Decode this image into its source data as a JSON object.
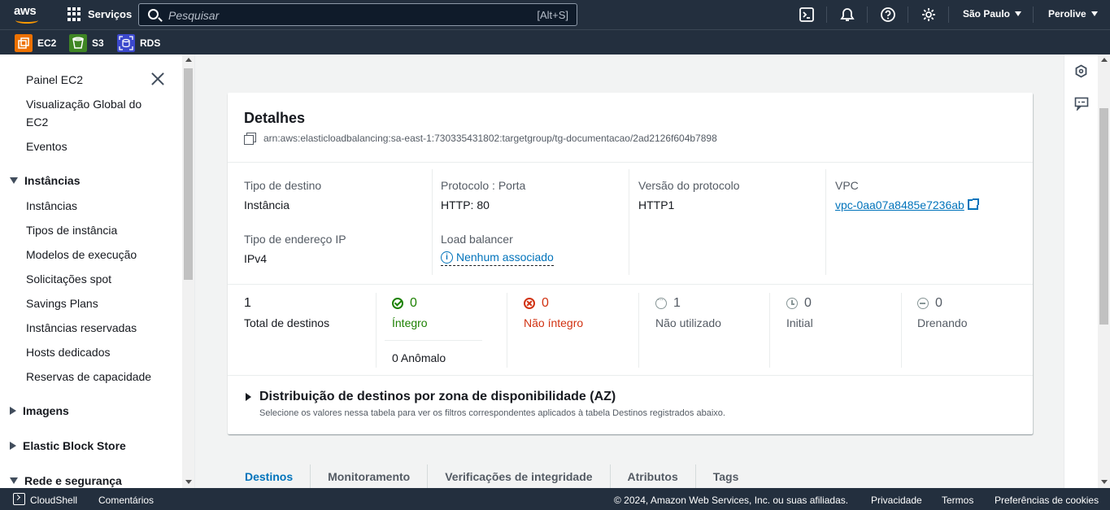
{
  "topnav": {
    "logo": "aws",
    "services_label": "Serviços",
    "search_placeholder": "Pesquisar",
    "search_shortcut": "[Alt+S]",
    "region": "São Paulo",
    "account": "Perolive",
    "icons": [
      "cloudshell-icon",
      "bell-icon",
      "help-icon",
      "gear-icon"
    ]
  },
  "favorites": [
    {
      "label": "EC2",
      "color": "#ed7100"
    },
    {
      "label": "S3",
      "color": "#3f8624"
    },
    {
      "label": "RDS",
      "color": "#3b48cc"
    }
  ],
  "sidebar": {
    "top_items": [
      "Painel EC2",
      "Visualização Global do",
      "EC2",
      "Eventos"
    ],
    "instances_header": "Instâncias",
    "instances_items": [
      "Instâncias",
      "Tipos de instância",
      "Modelos de execução",
      "Solicitações spot",
      "Savings Plans",
      "Instâncias reservadas",
      "Hosts dedicados",
      "Reservas de capacidade"
    ],
    "images_header": "Imagens",
    "ebs_header": "Elastic Block Store",
    "network_header": "Rede e segurança"
  },
  "details": {
    "title": "Detalhes",
    "arn": "arn:aws:elasticloadbalancing:sa-east-1:730335431802:targetgroup/tg-documentacao/2ad2126f604b7898",
    "target_type_label": "Tipo de destino",
    "target_type_value": "Instância",
    "protocol_label": "Protocolo : Porta",
    "protocol_value": "HTTP: 80",
    "protocol_version_label": "Versão do protocolo",
    "protocol_version_value": "HTTP1",
    "vpc_label": "VPC",
    "vpc_value": "vpc-0aa07a8485e7236ab",
    "ip_type_label": "Tipo de endereço IP",
    "ip_type_value": "IPv4",
    "lb_label": "Load balancer",
    "lb_value": "Nenhum associado",
    "stats": {
      "total_count": "1",
      "total_label": "Total de destinos",
      "healthy_count": "0",
      "healthy_label": "Íntegro",
      "anomalous_label": "0 Anômalo",
      "unhealthy_count": "0",
      "unhealthy_label": "Não íntegro",
      "unused_count": "1",
      "unused_label": "Não utilizado",
      "initial_count": "0",
      "initial_label": "Initial",
      "draining_count": "0",
      "draining_label": "Drenando"
    },
    "az_title": "Distribuição de destinos por zona de disponibilidade (AZ)",
    "az_desc": "Selecione os valores nessa tabela para ver os filtros correspondentes aplicados à tabela Destinos registrados abaixo."
  },
  "tabs": [
    "Destinos",
    "Monitoramento",
    "Verificações de integridade",
    "Atributos",
    "Tags"
  ],
  "footer": {
    "cloudshell": "CloudShell",
    "feedback": "Comentários",
    "copyright": "© 2024, Amazon Web Services, Inc. ou suas afiliadas.",
    "privacy": "Privacidade",
    "terms": "Termos",
    "cookies": "Preferências de cookies"
  }
}
